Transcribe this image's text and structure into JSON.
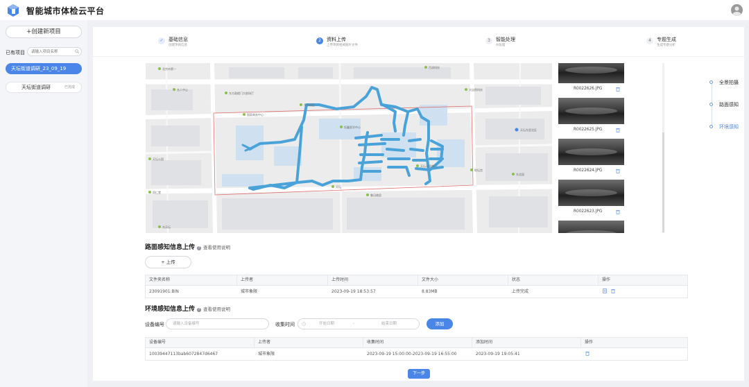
{
  "app": {
    "title": "智能城市体检云平台"
  },
  "sidebar": {
    "create_label": "+创建新项目",
    "existing_label": "已有项目",
    "search_placeholder": "请输入项目名称",
    "projects": [
      {
        "name": "天坛街道调研_23_09_19",
        "badge": ""
      },
      {
        "name": "天坛街道调研",
        "badge": "已完成"
      }
    ]
  },
  "steps": [
    {
      "number": "1",
      "title": "基础信息",
      "desc": "创建项目信息",
      "state": "done"
    },
    {
      "number": "2",
      "title": "资料上传",
      "desc": "上传项目相关图片文件",
      "state": "active"
    },
    {
      "number": "3",
      "title": "智能处理",
      "desc": "AI处理",
      "state": "pending"
    },
    {
      "number": "4",
      "title": "专题生成",
      "desc": "生成专题分析",
      "state": "pending"
    }
  ],
  "photos": [
    {
      "name": ""
    },
    {
      "name": "R0022626.JPG"
    },
    {
      "name": "R0022625.JPG"
    },
    {
      "name": "R0022624.JPG"
    },
    {
      "name": "R0022623.JPG"
    }
  ],
  "right_nav": [
    {
      "label": "全景拍摄"
    },
    {
      "label": "路面感知"
    },
    {
      "label": "环境感知",
      "active": true
    }
  ],
  "road": {
    "title": "路面感知信息上传",
    "help": "查看使用说明",
    "upload_label": "+ 上传",
    "columns": [
      "文件夹名称",
      "上传者",
      "上传时间",
      "文件大小",
      "状态",
      "操作"
    ],
    "rows": [
      [
        "23091901.BIN",
        "城市象限",
        "2023-09-19 18:53:57",
        "8.83MB",
        "上传完成",
        ""
      ]
    ]
  },
  "env": {
    "title": "环境感知信息上传",
    "help": "查看使用说明",
    "device_label": "设备编号",
    "device_placeholder": "请输入设备编号",
    "time_label": "收集时间",
    "start_placeholder": "开始日期",
    "range_sep": "-",
    "end_placeholder": "结束日期",
    "add_label": "添加",
    "columns": [
      "设备编号",
      "上传者",
      "收集时间",
      "添加时间",
      "操作"
    ],
    "rows": [
      [
        "10039447113bab6072847d6467",
        "城市象限",
        "2023-09-19 15:00:00-2023-09-19 16:55:00",
        "2023-09-19 19:05:41",
        ""
      ]
    ]
  },
  "next_label": "下一步",
  "map_labels": [
    "北京市第一",
    "名人中心",
    "东中校区",
    "百润科技",
    "东方鼓楼门大剧场厅",
    "国家商务中心",
    "钰鑫医学中心",
    "大自然科技",
    "天坛公园",
    "同仁堂",
    "东天坛",
    "天坛",
    "地坛宫",
    "天坛东门",
    "天坛东里北区",
    "东北园",
    "天坛公园南门",
    "鲁迅故居",
    "道桥北里",
    "前门大街",
    "中国北京"
  ],
  "colors": {
    "accent": "#4a86e8",
    "track": "#4aa3d8",
    "boundary": "#e26d6d"
  }
}
